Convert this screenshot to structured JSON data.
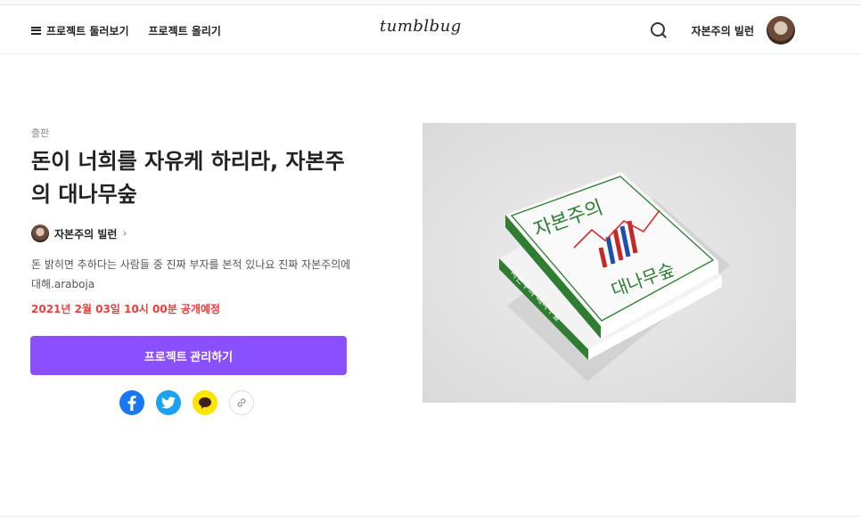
{
  "header": {
    "browse_label": "프로젝트 둘러보기",
    "upload_label": "프로젝트 올리기",
    "logo": "tumblbug",
    "user_name": "자본주의 빌런"
  },
  "project": {
    "category": "출판",
    "title": "돈이 너희를 자유케 하리라, 자본주의 대나무숲",
    "creator": "자본주의 빌런",
    "summary": "돈 밝히면 추하다는 사람들 중 진짜 부자를 본적 있나요 진짜 자본주의에 대해.araboja",
    "launch_date": "2021년 2월 03일 10시 00분 공개예정",
    "manage_button": "프로젝트 관리하기"
  },
  "share": {
    "facebook_icon": "facebook-icon",
    "twitter_icon": "twitter-icon",
    "kakaotalk_icon": "kakaotalk-icon",
    "link_icon": "link-icon"
  },
  "hero": {
    "cover_title_top": "자본주의",
    "cover_title_bottom": "대나무숲",
    "spine_title": "자본주의 대나무숲"
  },
  "colors": {
    "accent": "#8a4fff",
    "launch": "#f03c3c",
    "facebook": "#1877f2",
    "twitter": "#1da1f2",
    "kakao": "#fee500"
  }
}
